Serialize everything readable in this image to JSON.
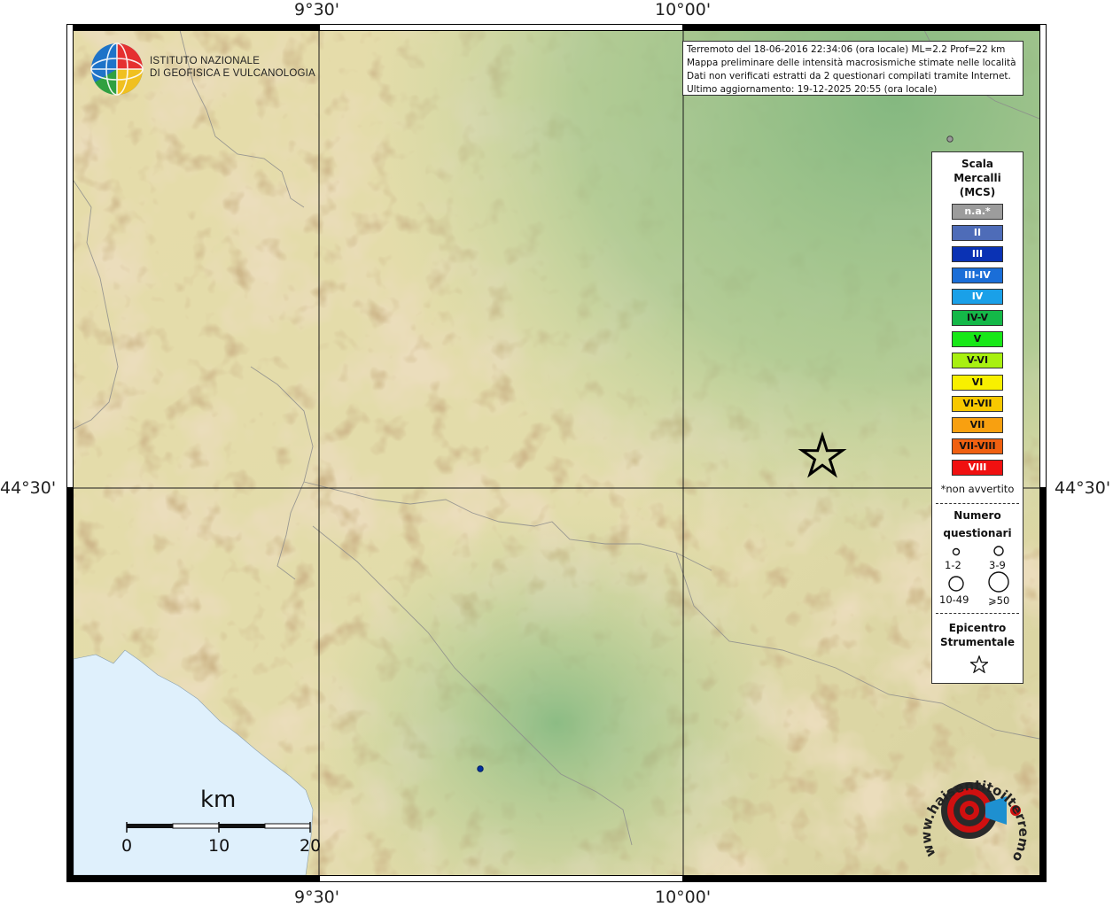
{
  "map": {
    "axes": {
      "top": [
        "9°30'",
        "10°00'"
      ],
      "bottom": [
        "9°30'",
        "10°00'"
      ],
      "left": [
        "44°30'"
      ],
      "right": [
        "44°30'"
      ]
    },
    "info_box": [
      "Terremoto del 18-06-2016 22:34:06 (ora locale) ML=2.2 Prof=22 km",
      "Mappa preliminare delle intensità macrosismiche stimate nelle località",
      "Dati non verificati estratti da 2 questionari compilati tramite Internet.",
      "Ultimo aggiornamento: 19-12-2025 20:55 (ora locale)"
    ],
    "institute": {
      "line1": "ISTITUTO NAZIONALE",
      "line2": "DI GEOFISICA E VULCANOLOGIA"
    },
    "scale_bar": {
      "unit": "km",
      "ticks": [
        "0",
        "10",
        "20"
      ]
    },
    "site_logo": {
      "text": "www.haisentitoilterremoto.it",
      "colors": {
        "ring": "#d01010",
        "dark": "#222222",
        "speaker": "#1e90d0"
      }
    },
    "epicenter": {
      "label": "epicenter-star"
    },
    "observations": [
      {
        "name": "point-1",
        "intensity": "n.a.",
        "color": "#9a9a9a"
      },
      {
        "name": "point-2",
        "intensity": "III",
        "color": "#0030a0"
      }
    ]
  },
  "legend": {
    "title1": "Scala",
    "title2": "Mercalli",
    "title3": "(MCS)",
    "classes": [
      {
        "label": "n.a.*",
        "color": "#9c9c9c"
      },
      {
        "label": "II",
        "color": "#4e6cb8"
      },
      {
        "label": "III",
        "color": "#0a32b4"
      },
      {
        "label": "III-IV",
        "color": "#1a6ed8"
      },
      {
        "label": "IV",
        "color": "#1aa0e8"
      },
      {
        "label": "IV-V",
        "color": "#14b848"
      },
      {
        "label": "V",
        "color": "#18e818"
      },
      {
        "label": "V-VI",
        "color": "#a8f010"
      },
      {
        "label": "VI",
        "color": "#f8f000"
      },
      {
        "label": "VI-VII",
        "color": "#f8c800"
      },
      {
        "label": "VII",
        "color": "#f8a010"
      },
      {
        "label": "VII-VIII",
        "color": "#f06010"
      },
      {
        "label": "VIII",
        "color": "#f01010"
      }
    ],
    "not_felt_note": "*non avvertito",
    "count_title1": "Numero",
    "count_title2": "questionari",
    "count_classes": [
      "1-2",
      "3-9",
      "10-49",
      "⩾50"
    ],
    "epicenter_title1": "Epicentro",
    "epicenter_title2": "Strumentale"
  }
}
